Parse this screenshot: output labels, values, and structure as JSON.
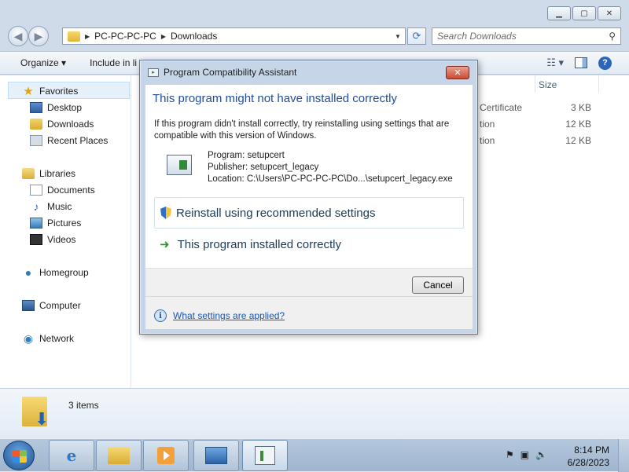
{
  "explorer": {
    "breadcrumb": [
      "PC-PC-PC-PC",
      "Downloads"
    ],
    "search_placeholder": "Search Downloads",
    "toolbar": {
      "organize": "Organize ▾",
      "include": "Include in li"
    },
    "column_size": "Size",
    "files": [
      {
        "type": "Certificate",
        "size": "3 KB"
      },
      {
        "type": "tion",
        "size": "12 KB"
      },
      {
        "type": "tion",
        "size": "12 KB"
      }
    ],
    "nav": {
      "favorites": "Favorites",
      "desktop": "Desktop",
      "downloads": "Downloads",
      "recent": "Recent Places",
      "libraries": "Libraries",
      "documents": "Documents",
      "music": "Music",
      "pictures": "Pictures",
      "videos": "Videos",
      "homegroup": "Homegroup",
      "computer": "Computer",
      "network": "Network"
    },
    "details_count": "3 items"
  },
  "dialog": {
    "title": "Program Compatibility Assistant",
    "heading": "This program might not have installed correctly",
    "message": "If this program didn't install correctly, try reinstalling using settings that are compatible with this version of Windows.",
    "program": "Program: setupcert",
    "publisher": "Publisher: setupcert_legacy",
    "location": "Location: C:\\Users\\PC-PC-PC-PC\\Do...\\setupcert_legacy.exe",
    "option_reinstall": "Reinstall using recommended settings",
    "option_installed": "This program installed correctly",
    "cancel": "Cancel",
    "help_link": "What settings are applied?"
  },
  "taskbar": {
    "time": "8:14 PM",
    "date": "6/28/2023"
  },
  "colors": {
    "heading_blue": "#1f4d9a",
    "link_blue": "#1a57b0",
    "close_red": "#c94c33"
  }
}
